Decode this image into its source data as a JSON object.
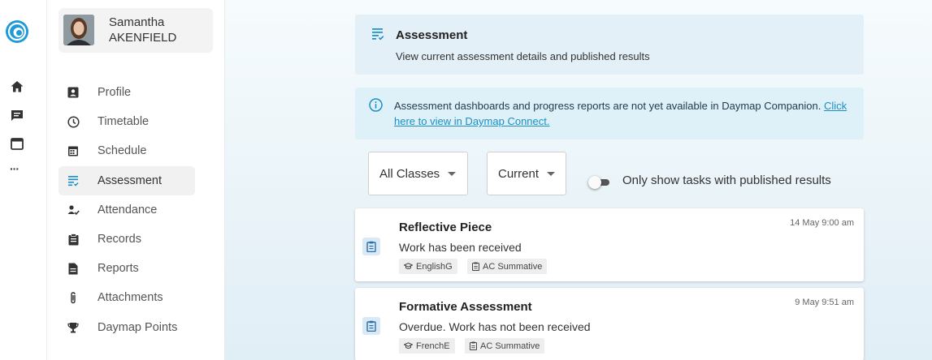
{
  "profile": {
    "first_name": "Samantha",
    "last_name": "AKENFIELD"
  },
  "rail": {
    "icons": [
      "home-icon",
      "chat-icon",
      "calendar-icon",
      "more-icon"
    ],
    "more_label": "···"
  },
  "nav": {
    "items": [
      {
        "label": "Profile",
        "icon": "profile-card-icon"
      },
      {
        "label": "Timetable",
        "icon": "clock-icon"
      },
      {
        "label": "Schedule",
        "icon": "calendar-grid-icon"
      },
      {
        "label": "Assessment",
        "icon": "assessment-list-icon",
        "active": true
      },
      {
        "label": "Attendance",
        "icon": "person-check-icon"
      },
      {
        "label": "Records",
        "icon": "clipboard-icon"
      },
      {
        "label": "Reports",
        "icon": "document-icon"
      },
      {
        "label": "Attachments",
        "icon": "paperclip-icon"
      },
      {
        "label": "Daymap Points",
        "icon": "trophy-icon"
      }
    ]
  },
  "banner": {
    "title": "Assessment",
    "subtitle": "View current assessment details and published results"
  },
  "info": {
    "text": "Assessment dashboards and progress reports are not yet available in Daymap Companion.",
    "link": "Click here to view in Daymap Connect."
  },
  "filters": {
    "class_select": "All Classes",
    "period_select": "Current",
    "toggle_label": "Only show tasks with published results",
    "toggle_on": false
  },
  "tasks": [
    {
      "title": "Reflective Piece",
      "date": "14 May 9:00 am",
      "status": "Work has been received",
      "class_tag": "EnglishG",
      "type_tag": "AC Summative"
    },
    {
      "title": "Formative Assessment",
      "date": "9 May 9:51 am",
      "status": "Overdue. Work has not been received",
      "class_tag": "FrenchE",
      "type_tag": "AC Summative"
    }
  ],
  "colors": {
    "accent": "#1a8fc4",
    "banner_bg": "#e3f0f7",
    "info_bg": "#dff1f8"
  }
}
